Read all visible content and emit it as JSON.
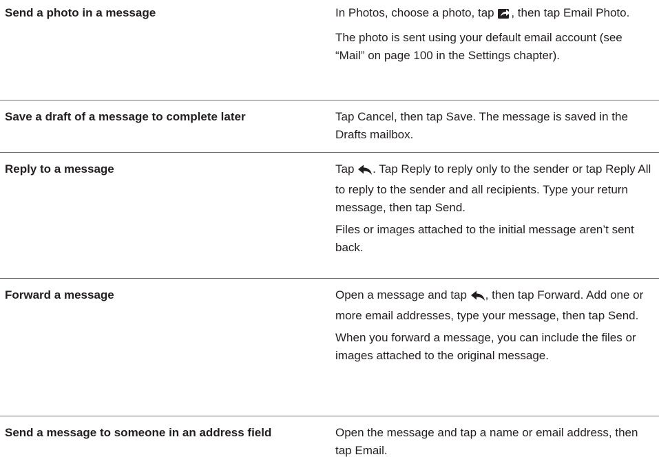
{
  "rows": [
    {
      "task": "Send a photo in a message",
      "p1_before": "In Photos, choose a photo, tap ",
      "p1_icon": "share-icon",
      "p1_after": ", then tap Email Photo.",
      "p2": "The photo is sent using your default email account (see “Mail” on page 100 in the Settings chapter)."
    },
    {
      "task": "Save a draft of a message to complete later",
      "p1": "Tap Cancel, then tap Save. The message is saved in the Drafts mailbox."
    },
    {
      "task": "Reply to a message",
      "p1_before": "Tap ",
      "p1_icon": "reply-arrow-icon",
      "p1_after": ". Tap Reply to reply only to the sender or tap Reply All to reply to the sender and all recipients. Type your return message, then tap Send.",
      "p2": "Files or images attached to the initial message aren’t sent back."
    },
    {
      "task": "Forward a message",
      "p1_before": "Open a message and tap ",
      "p1_icon": "reply-arrow-icon",
      "p1_after": ", then tap Forward. Add one or more email addresses, type your message, then tap Send.",
      "p2": "When you forward a message, you can include the files or images attached to the original message."
    },
    {
      "task": "Send a message to someone in an address field",
      "p1": "Open the message and tap a name or email address, then tap Email."
    }
  ]
}
